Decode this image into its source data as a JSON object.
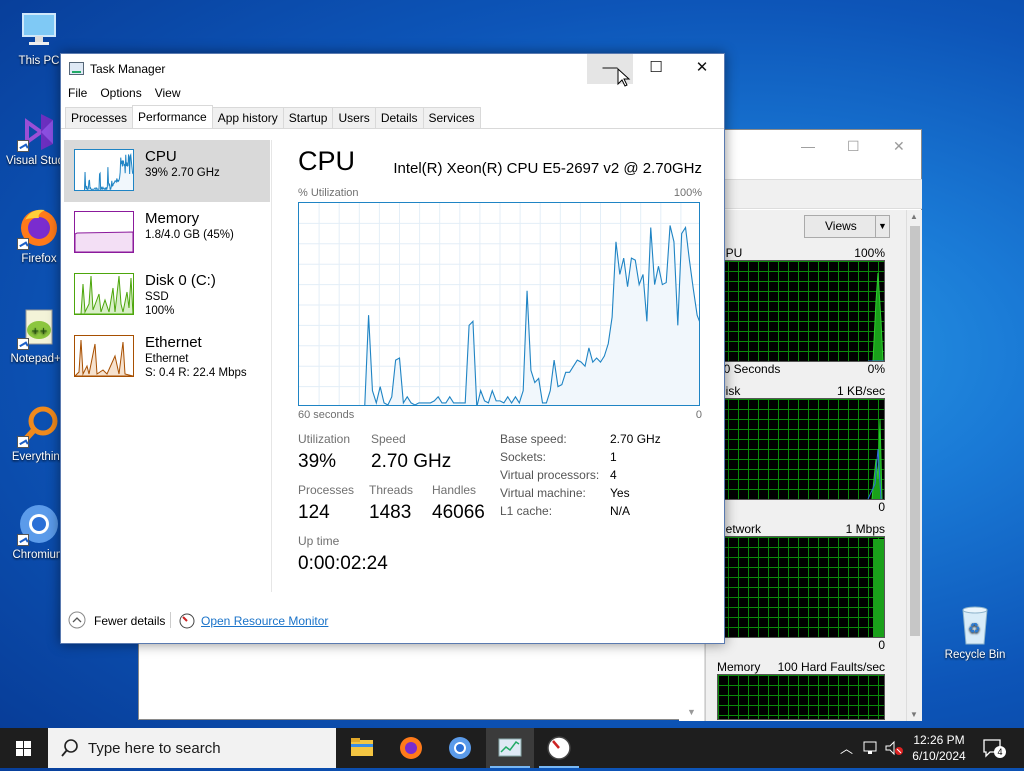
{
  "desktop": {
    "icons": [
      {
        "label": "This PC",
        "icon": "computer-icon"
      },
      {
        "label": "Visual Studio 2017",
        "icon": "visual-studio-icon"
      },
      {
        "label": "Firefox",
        "icon": "firefox-icon"
      },
      {
        "label": "Notepad++",
        "icon": "notepad-plus-plus-icon"
      },
      {
        "label": "Everything",
        "icon": "everything-search-icon"
      },
      {
        "label": "Chromium",
        "icon": "chromium-icon"
      },
      {
        "label": "Recycle Bin",
        "icon": "recycle-bin-icon"
      }
    ]
  },
  "bg_window": {
    "views_label": "Views",
    "sections": [
      {
        "title": "CPU",
        "right": "100%",
        "footer_left": "60 Seconds",
        "footer_right": "0%"
      },
      {
        "title": "Disk",
        "right": "1 KB/sec",
        "footer_left": "",
        "footer_right": "0"
      },
      {
        "title": "Network",
        "right": "1 Mbps",
        "footer_left": "",
        "footer_right": "0"
      },
      {
        "title": "Memory",
        "right": "100 Hard Faults/sec",
        "footer_left": "",
        "footer_right": ""
      }
    ]
  },
  "task_manager": {
    "title": "Task Manager",
    "menu": [
      "File",
      "Options",
      "View"
    ],
    "tabs": [
      "Processes",
      "Performance",
      "App history",
      "Startup",
      "Users",
      "Details",
      "Services"
    ],
    "active_tab": "Performance",
    "sidebar": [
      {
        "name": "CPU",
        "line1": "39% 2.70 GHz",
        "line2": "",
        "color": "#1f84c4"
      },
      {
        "name": "Memory",
        "line1": "1.8/4.0 GB (45%)",
        "line2": "",
        "color": "#8b1a9c"
      },
      {
        "name": "Disk 0 (C:)",
        "line1": "SSD",
        "line2": "100%",
        "color": "#4da60c"
      },
      {
        "name": "Ethernet",
        "line1": "Ethernet",
        "line2": "S: 0.4  R: 22.4 Mbps",
        "color": "#a74f01"
      }
    ],
    "cpu": {
      "heading": "CPU",
      "model": "Intel(R) Xeon(R) CPU E5-2697 v2 @ 2.70GHz",
      "graph_label": "% Utilization",
      "graph_max": "100%",
      "graph_time": "60 seconds",
      "graph_min": "0",
      "utilization": [
        0,
        0,
        0,
        0,
        0,
        0,
        0,
        0,
        0,
        0,
        0,
        0,
        0,
        0,
        0,
        0,
        0,
        0,
        45,
        8,
        2,
        10,
        2,
        1,
        5,
        23,
        24,
        2,
        5,
        2,
        1,
        2,
        2,
        2,
        2,
        3,
        5,
        2,
        2,
        5,
        2,
        2,
        2,
        2,
        40,
        42,
        0,
        8,
        3,
        2,
        8,
        3,
        3,
        2,
        5,
        2,
        5,
        2,
        8,
        57,
        18,
        12,
        14,
        2,
        2,
        8,
        23,
        10,
        11,
        17,
        17,
        20,
        23,
        22,
        20,
        29,
        22,
        24,
        22,
        25,
        31,
        44,
        81,
        65,
        73,
        59,
        73,
        72,
        60,
        65,
        42,
        88,
        60,
        69,
        60,
        61,
        89,
        81,
        40,
        85,
        88,
        72,
        58,
        45,
        40
      ],
      "stats": [
        {
          "label": "Utilization",
          "value": "39%"
        },
        {
          "label": "Speed",
          "value": "2.70 GHz"
        },
        {
          "label": "Processes",
          "value": "124"
        },
        {
          "label": "Threads",
          "value": "1483"
        },
        {
          "label": "Handles",
          "value": "46066"
        },
        {
          "label": "Up time",
          "value": "0:00:02:24"
        }
      ],
      "details": [
        {
          "k": "Base speed:",
          "v": "2.70 GHz"
        },
        {
          "k": "Sockets:",
          "v": "1"
        },
        {
          "k": "Virtual processors:",
          "v": "4"
        },
        {
          "k": "Virtual machine:",
          "v": "Yes"
        },
        {
          "k": "L1 cache:",
          "v": "N/A"
        }
      ]
    },
    "footer": {
      "fewer_details": "Fewer details",
      "resource_monitor": "Open Resource Monitor"
    }
  },
  "taskbar": {
    "search_placeholder": "Type here to search",
    "apps": [
      "file-explorer-icon",
      "firefox-icon",
      "chromium-icon",
      "task-manager-icon",
      "resource-monitor-icon"
    ],
    "time": "12:26 PM",
    "date": "6/10/2024",
    "notification_count": "4"
  }
}
